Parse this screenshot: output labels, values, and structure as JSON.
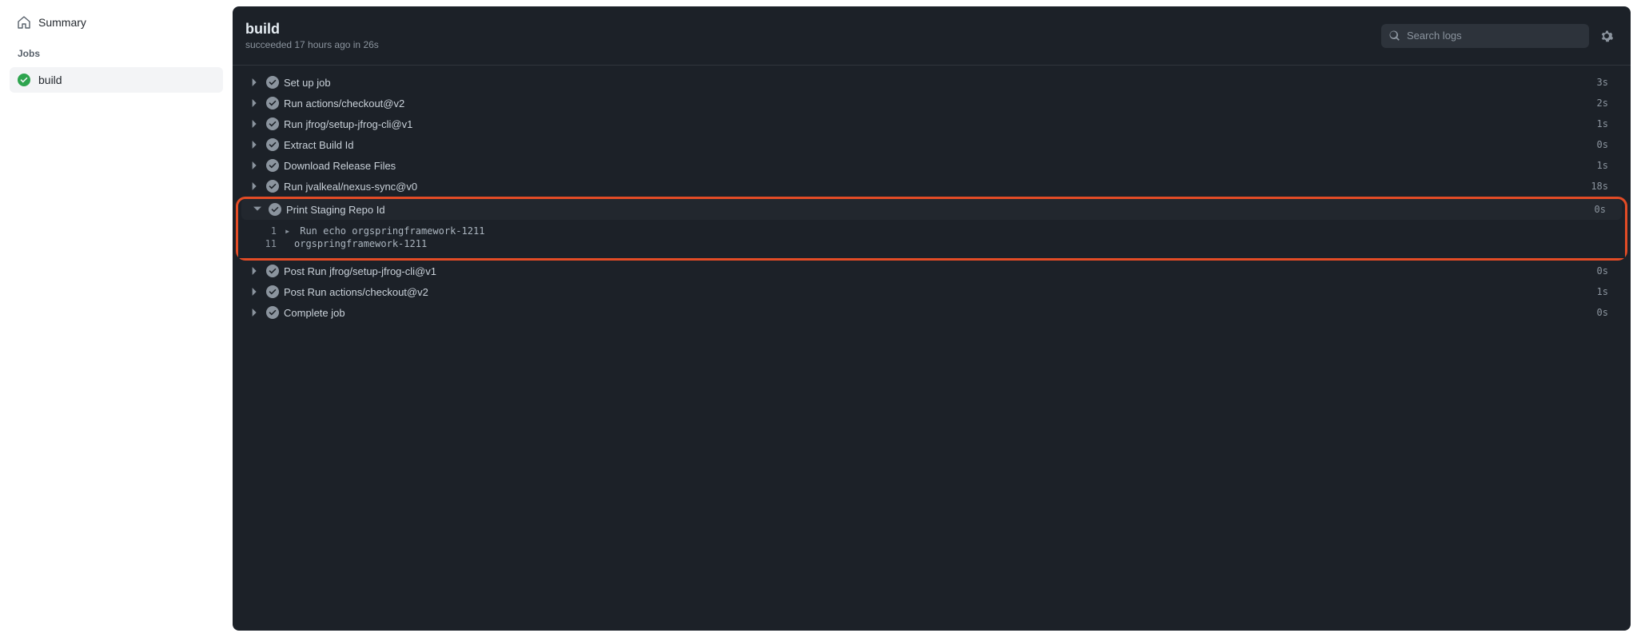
{
  "sidebar": {
    "summary_label": "Summary",
    "jobs_heading": "Jobs",
    "jobs": [
      {
        "label": "build",
        "status": "success",
        "active": true
      }
    ]
  },
  "header": {
    "title": "build",
    "subtitle": "succeeded 17 hours ago in 26s",
    "search_placeholder": "Search logs"
  },
  "steps": [
    {
      "name": "Set up job",
      "duration": "3s",
      "expanded": false,
      "highlight": false
    },
    {
      "name": "Run actions/checkout@v2",
      "duration": "2s",
      "expanded": false,
      "highlight": false
    },
    {
      "name": "Run jfrog/setup-jfrog-cli@v1",
      "duration": "1s",
      "expanded": false,
      "highlight": false
    },
    {
      "name": "Extract Build Id",
      "duration": "0s",
      "expanded": false,
      "highlight": false
    },
    {
      "name": "Download Release Files",
      "duration": "1s",
      "expanded": false,
      "highlight": false
    },
    {
      "name": "Run jvalkeal/nexus-sync@v0",
      "duration": "18s",
      "expanded": false,
      "highlight": false
    },
    {
      "name": "Print Staging Repo Id",
      "duration": "0s",
      "expanded": true,
      "highlight": true,
      "log": [
        {
          "n": "1",
          "disclosure": "▸",
          "text": "Run echo orgspringframework-1211"
        },
        {
          "n": "11",
          "disclosure": "",
          "text": "orgspringframework-1211"
        }
      ]
    },
    {
      "name": "Post Run jfrog/setup-jfrog-cli@v1",
      "duration": "0s",
      "expanded": false,
      "highlight": false
    },
    {
      "name": "Post Run actions/checkout@v2",
      "duration": "1s",
      "expanded": false,
      "highlight": false
    },
    {
      "name": "Complete job",
      "duration": "0s",
      "expanded": false,
      "highlight": false
    }
  ],
  "colors": {
    "success": "#2da44e",
    "panel_bg": "#1c2128",
    "highlight_border": "#e34c26"
  }
}
